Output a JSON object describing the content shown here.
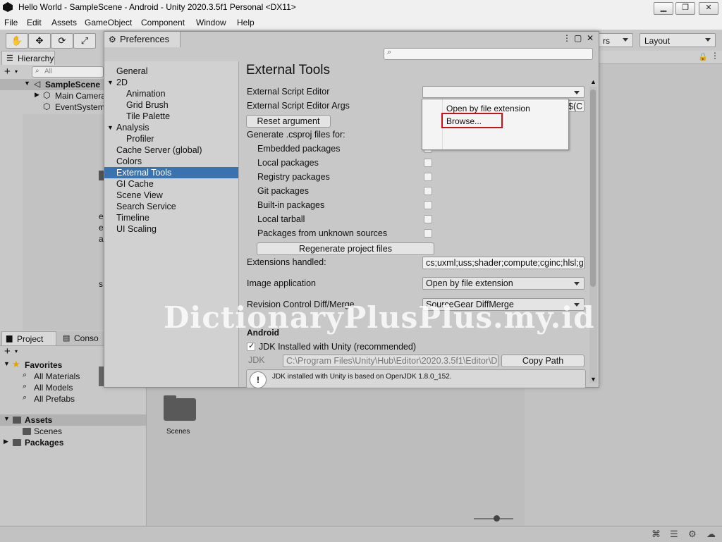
{
  "window": {
    "title": "Hello World - SampleScene - Android - Unity 2020.3.5f1 Personal <DX11>",
    "minimize": "▁",
    "restore": "❐",
    "close": "✕"
  },
  "menu": [
    "File",
    "Edit",
    "Assets",
    "GameObject",
    "Component",
    "Window",
    "Help"
  ],
  "toolbar": {
    "layers_partial": "rs",
    "layout": "Layout"
  },
  "hierarchy": {
    "tab": "Hierarchy",
    "search_placeholder": "All",
    "scene": "SampleScene",
    "items": [
      "Main Camera",
      "EventSystem"
    ]
  },
  "inspector_edge_text": [
    "er",
    "er",
    "al",
    "s"
  ],
  "dialog": {
    "title": "Preferences",
    "nav": [
      {
        "label": "General",
        "indent": 0
      },
      {
        "label": "2D",
        "indent": 0,
        "expander": true
      },
      {
        "label": "Animation",
        "indent": 2
      },
      {
        "label": "Grid Brush",
        "indent": 2
      },
      {
        "label": "Tile Palette",
        "indent": 2
      },
      {
        "label": "Analysis",
        "indent": 0,
        "expander": true
      },
      {
        "label": "Profiler",
        "indent": 2
      },
      {
        "label": "Cache Server (global)",
        "indent": 0
      },
      {
        "label": "Colors",
        "indent": 0
      },
      {
        "label": "External Tools",
        "indent": 0,
        "selected": true
      },
      {
        "label": "GI Cache",
        "indent": 0
      },
      {
        "label": "Scene View",
        "indent": 0
      },
      {
        "label": "Search Service",
        "indent": 0
      },
      {
        "label": "Timeline",
        "indent": 0
      },
      {
        "label": "UI Scaling",
        "indent": 0
      }
    ],
    "content": {
      "heading": "External Tools",
      "script_editor_label": "External Script Editor",
      "script_editor_args_label": "External Script Editor Args",
      "script_editor_args_value": "$(C",
      "reset_argument": "Reset argument",
      "generate_label": "Generate .csproj files for:",
      "packages": [
        {
          "label": "Embedded packages",
          "checked": false
        },
        {
          "label": "Local packages",
          "checked": false
        },
        {
          "label": "Registry packages",
          "checked": false
        },
        {
          "label": "Git packages",
          "checked": false
        },
        {
          "label": "Built-in packages",
          "checked": false
        },
        {
          "label": "Local tarball",
          "checked": false
        },
        {
          "label": "Packages from unknown sources",
          "checked": false
        }
      ],
      "regenerate": "Regenerate project files",
      "extensions_label": "Extensions handled:",
      "extensions_value": "cs;uxml;uss;shader;compute;cginc;hlsl;g",
      "image_app_label": "Image application",
      "image_app_value": "Open by file extension",
      "revision_label": "Revision Control Diff/Merge",
      "revision_value": "SourceGear DiffMerge",
      "android_heading": "Android",
      "jdk_checkbox": "JDK Installed with Unity (recommended)",
      "jdk_label": "JDK",
      "jdk_path": "C:\\Program Files\\Unity\\Hub\\Editor\\2020.3.5f1\\Editor\\D",
      "copy_path": "Copy Path",
      "info_line": "JDK installed with Unity is based on OpenJDK 1.8.0_152."
    },
    "popup": [
      "Open by file extension",
      "Browse..."
    ]
  },
  "project": {
    "tabs": [
      "Project",
      "Conso"
    ],
    "favorites": "Favorites",
    "favorite_items": [
      "All Materials",
      "All Models",
      "All Prefabs"
    ],
    "assets": "Assets",
    "asset_children": [
      "Scenes"
    ],
    "packages": "Packages",
    "folder_tile": "Scenes"
  },
  "watermark": "DictionaryPlusPlus.my.id",
  "colors": {
    "selection": "#3a72b0",
    "highlight_box": "#d10f19"
  }
}
